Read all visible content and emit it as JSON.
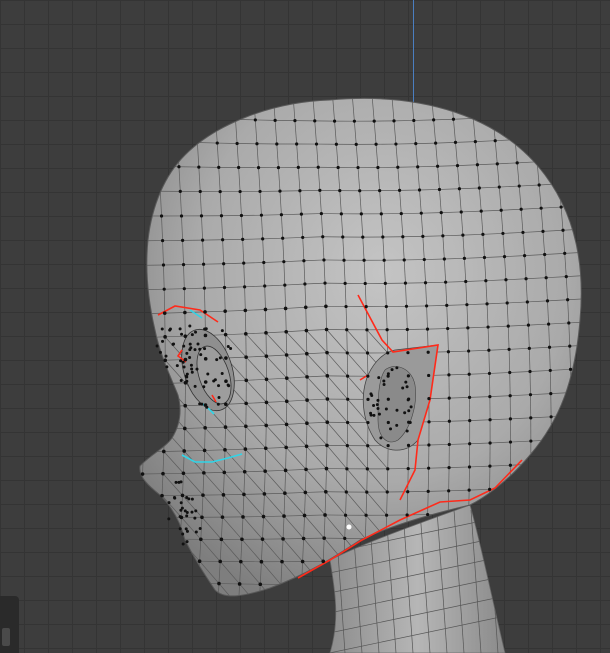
{
  "viewport": {
    "view": "side",
    "mode": "edit",
    "object": "head mesh"
  },
  "colors": {
    "background": "#3d3d3d",
    "grid": "#343434",
    "mesh": "#a8a8a8",
    "wire": "#555555",
    "vertex": "#111111",
    "seam": "#ff2a1a",
    "selected_edge": "#2fd5e8",
    "active_vertex": "#ffffff",
    "axis_z": "#4a7ec0"
  }
}
